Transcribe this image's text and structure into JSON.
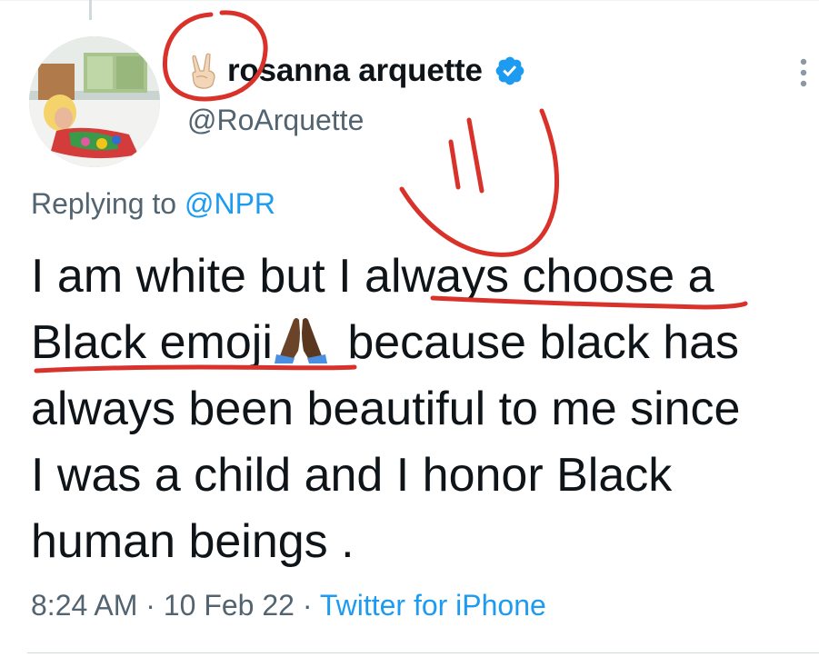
{
  "tweet": {
    "author": {
      "display_name": "rosanna arquette",
      "handle": "@RoArquette",
      "name_emoji": "victory-hand-emoji",
      "verified_badge": "verified-check-icon"
    },
    "reply": {
      "prefix": "Replying to",
      "mention": "@NPR"
    },
    "text": {
      "line1": "I am white but I always choose a",
      "line2a": "Black emoji",
      "line2_emoji": "folded-hands-emoji",
      "line2b": " because black has",
      "line3": "always been beautiful to me since",
      "line4": "I was a child and I honor Black",
      "line5": "human beings ."
    },
    "meta": {
      "time": "8:24 AM",
      "separator": " · ",
      "date": "10 Feb 22",
      "source": "Twitter for iPhone"
    }
  },
  "colors": {
    "text": "#0f1419",
    "secondary": "#536471",
    "link": "#1d9bf0",
    "annotation_red": "#d8322a"
  }
}
